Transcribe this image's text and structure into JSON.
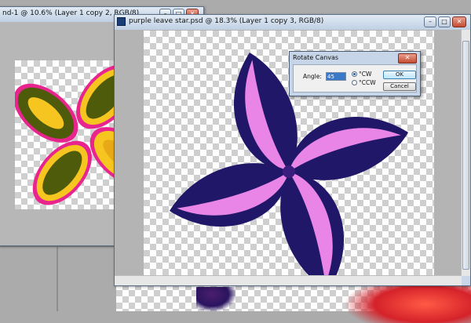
{
  "background_window": {
    "title": "nd-1 @ 10.6% (Layer 1 copy 2, RGB/8)"
  },
  "main_window": {
    "title": "purple leave star.psd @ 18.3% (Layer 1 copy 3, RGB/8)"
  },
  "dialog": {
    "title": "Rotate Canvas",
    "angle_label": "Angle:",
    "angle_value": "45",
    "cw_label": "°CW",
    "ccw_label": "°CCW",
    "ok_label": "OK",
    "cancel_label": "Cancel"
  },
  "window_controls": {
    "minimize_glyph": "–",
    "maximize_glyph": "□",
    "close_glyph": "✕"
  },
  "colors": {
    "leaf_dark": "#211769",
    "leaf_pink": "#e985e6",
    "leaf_green": "#4d5b0a",
    "leaf_yellow": "#f6c51f",
    "leaf_magenta": "#e8248f",
    "leaf_red": "#d5222a"
  }
}
